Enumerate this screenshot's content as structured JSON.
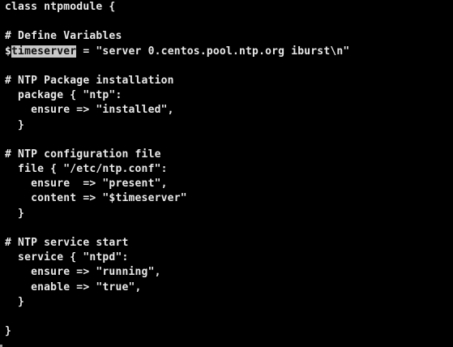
{
  "editor": {
    "lines": [
      "class ntpmodule {",
      "",
      "# Define Variables",
      "= \"server 0.centos.pool.ntp.org iburst\\n\"",
      "",
      "# NTP Package installation",
      "  package { \"ntp\":",
      "    ensure => \"installed\",",
      "  }",
      "",
      "# NTP configuration file",
      "  file { \"/etc/ntp.conf\":",
      "    ensure  => \"present\",",
      "    content => \"$timeserver\"",
      "  }",
      "",
      "# NTP service start",
      "  service { \"ntpd\":",
      "    ensure => \"running\",",
      "    enable => \"true\",",
      "  }",
      "",
      "}"
    ],
    "variable_sigil": "$",
    "variable_name": "timeserver"
  }
}
